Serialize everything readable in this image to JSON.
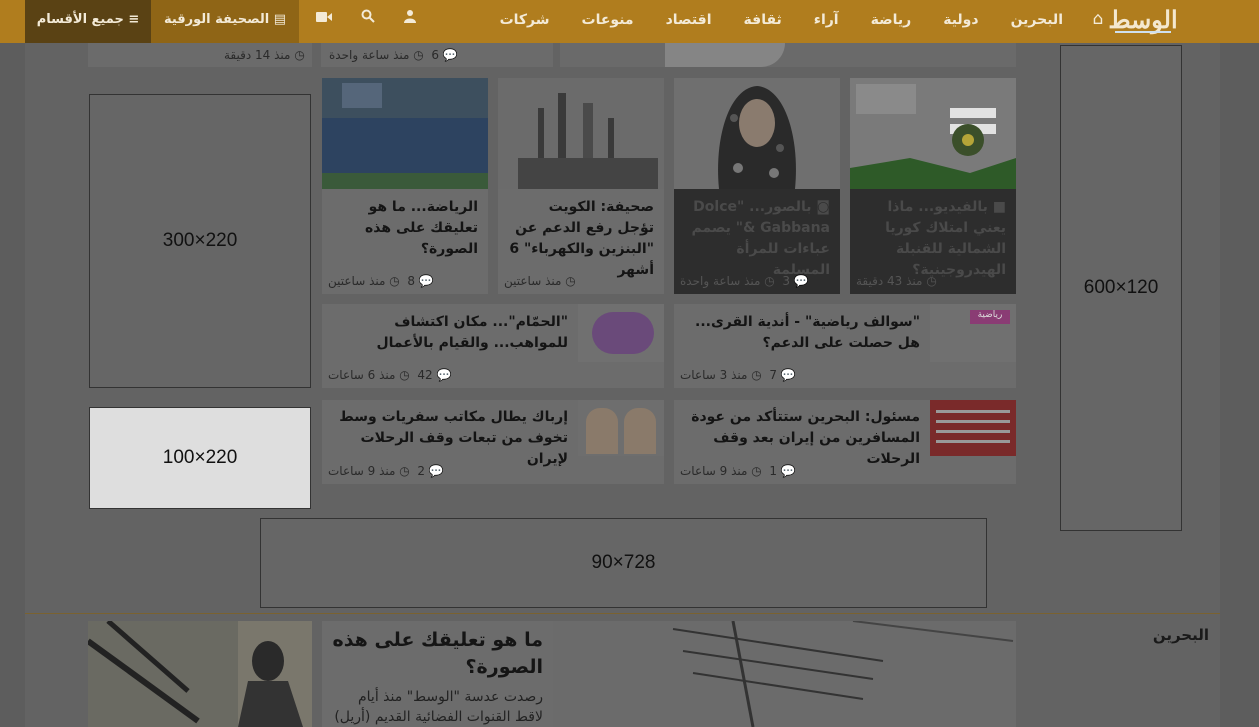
{
  "nav": {
    "logo": "الوسط",
    "items": [
      "البحرين",
      "دولية",
      "رياضة",
      "آراء",
      "ثقافة",
      "اقتصاد",
      "منوعات",
      "شركات"
    ],
    "paper_label": "الصحيفة الورقية",
    "all_sections_label": "جميع الأقسام"
  },
  "top_strip": [
    {
      "time": "منذ ساعة واحدة",
      "comments": "6"
    },
    {
      "time": "منذ 14 دقيقة",
      "comments": ""
    }
  ],
  "ads": {
    "skyscraper": "120×600",
    "rect_large": "220×300",
    "rect_small": "220×100",
    "leaderboard": "728×90"
  },
  "cards": [
    {
      "title": "بالفيديو... ماذا يعني امتلاك كوريا الشمالية للقنبلة الهيدروجينية؟",
      "time": "منذ 43 دقيقة",
      "comments": ""
    },
    {
      "title": "بالصور... \"Dolce & Gabbana\" يصمم عباءات للمرأة المسلمة",
      "time": "منذ ساعة واحدة",
      "comments": "3"
    },
    {
      "title": "صحيفة: الكويت تؤجل رفع الدعم عن \"البنزين والكهرباء\" 6 أشهر",
      "time": "منذ ساعتين",
      "comments": ""
    },
    {
      "title": "الرياضة... ما هو تعليقك على هذه الصورة؟",
      "time": "منذ ساعتين",
      "comments": "8"
    }
  ],
  "list_items": [
    {
      "title": "\"سوالف رياضية\" - أندية القرى... هل حصلت على الدعم؟",
      "time": "منذ 3 ساعات",
      "comments": "7"
    },
    {
      "title": "\"الحمّام\"... مكان اكتشاف للمواهب... والقيام بالأعمال",
      "time": "منذ 6 ساعات",
      "comments": "42"
    },
    {
      "title": "مسئول: البحرين ستتأكد من عودة المسافرين من إيران بعد وقف الرحلات",
      "time": "منذ 9 ساعات",
      "comments": "1"
    },
    {
      "title": "إرباك يطال مكاتب سفريات وسط تخوف من تبعات وقف الرحلات لإيران",
      "time": "منذ 9 ساعات",
      "comments": "2"
    }
  ],
  "section": {
    "title": "البحرين",
    "feature_title": "ما هو تعليقك على هذه الصورة؟",
    "feature_text": "رصدت عدسة \"الوسط\" منذ أيام لاقط القنوات الفضائية القديم (أريل)"
  }
}
